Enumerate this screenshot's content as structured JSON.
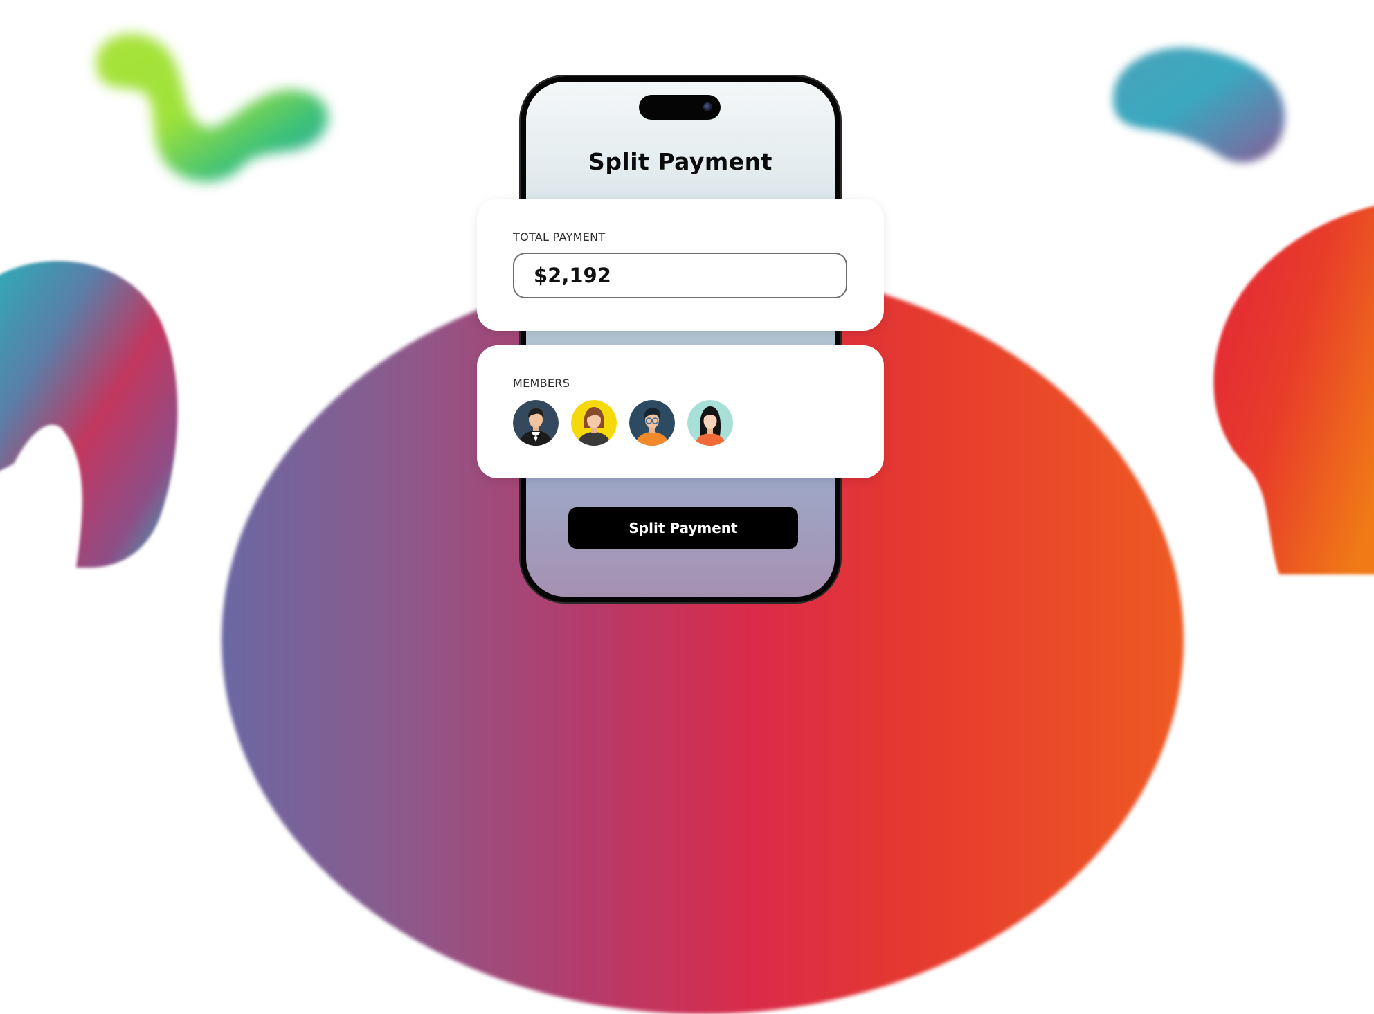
{
  "screen": {
    "title": "Split Payment"
  },
  "total_card": {
    "label": "TOTAL PAYMENT",
    "amount": "$2,192"
  },
  "members_card": {
    "label": "MEMBERS",
    "members": [
      {
        "icon": "man-bowtie-avatar",
        "bg": "#34495e"
      },
      {
        "icon": "woman-brown-hair-avatar",
        "bg": "#f5d90a"
      },
      {
        "icon": "man-glasses-avatar",
        "bg": "#2c4a62"
      },
      {
        "icon": "woman-black-hair-avatar",
        "bg": "#a8e0d8"
      }
    ]
  },
  "action": {
    "split_label": "Split Payment"
  },
  "colors": {
    "button_bg": "#000000",
    "card_bg": "#ffffff"
  }
}
